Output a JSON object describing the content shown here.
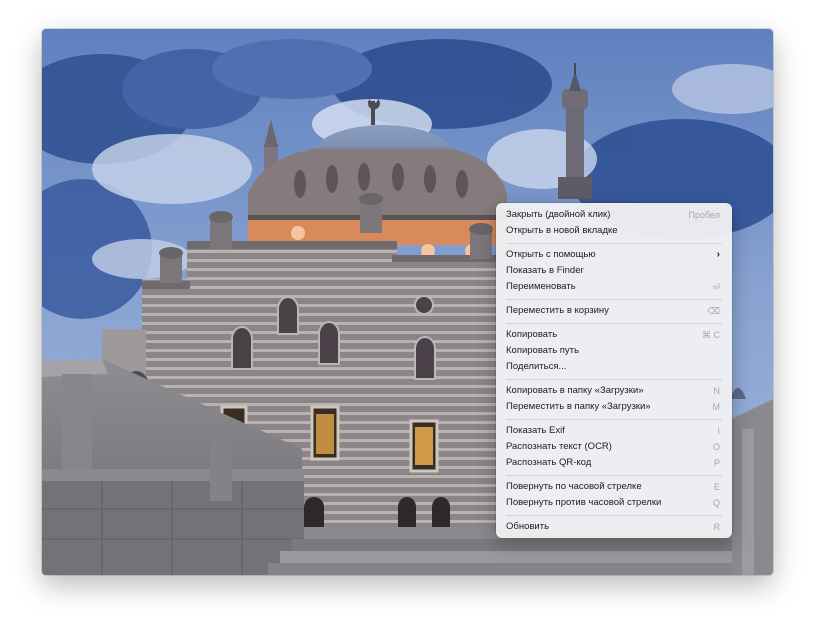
{
  "menu": {
    "groups": [
      [
        {
          "label": "Закрыть (двойной клик)",
          "shortcut": "Пробел"
        },
        {
          "label": "Открыть в новой вкладке",
          "shortcut": ""
        }
      ],
      [
        {
          "label": "Открыть с помощью",
          "shortcut": "›"
        },
        {
          "label": "Показать в Finder",
          "shortcut": ""
        },
        {
          "label": "Переименовать",
          "shortcut": "⏎"
        }
      ],
      [
        {
          "label": "Переместить в корзину",
          "shortcut": "⌫"
        }
      ],
      [
        {
          "label": "Копировать",
          "shortcut": "⌘ C"
        },
        {
          "label": "Копировать путь",
          "shortcut": ""
        },
        {
          "label": "Поделиться...",
          "shortcut": ""
        }
      ],
      [
        {
          "label": "Копировать в папку «Загрузки»",
          "shortcut": "N"
        },
        {
          "label": "Переместить в папку «Загрузки»",
          "shortcut": "M"
        }
      ],
      [
        {
          "label": "Показать Exif",
          "shortcut": "I"
        },
        {
          "label": "Распознать текст (OCR)",
          "shortcut": "O"
        },
        {
          "label": "Распознать QR-код",
          "shortcut": "P"
        }
      ],
      [
        {
          "label": "Повернуть по часовой стрелке",
          "shortcut": "E"
        },
        {
          "label": "Повернуть против часовой стрелки",
          "shortcut": "Q"
        }
      ],
      [
        {
          "label": "Обновить",
          "shortcut": "R"
        }
      ]
    ]
  }
}
